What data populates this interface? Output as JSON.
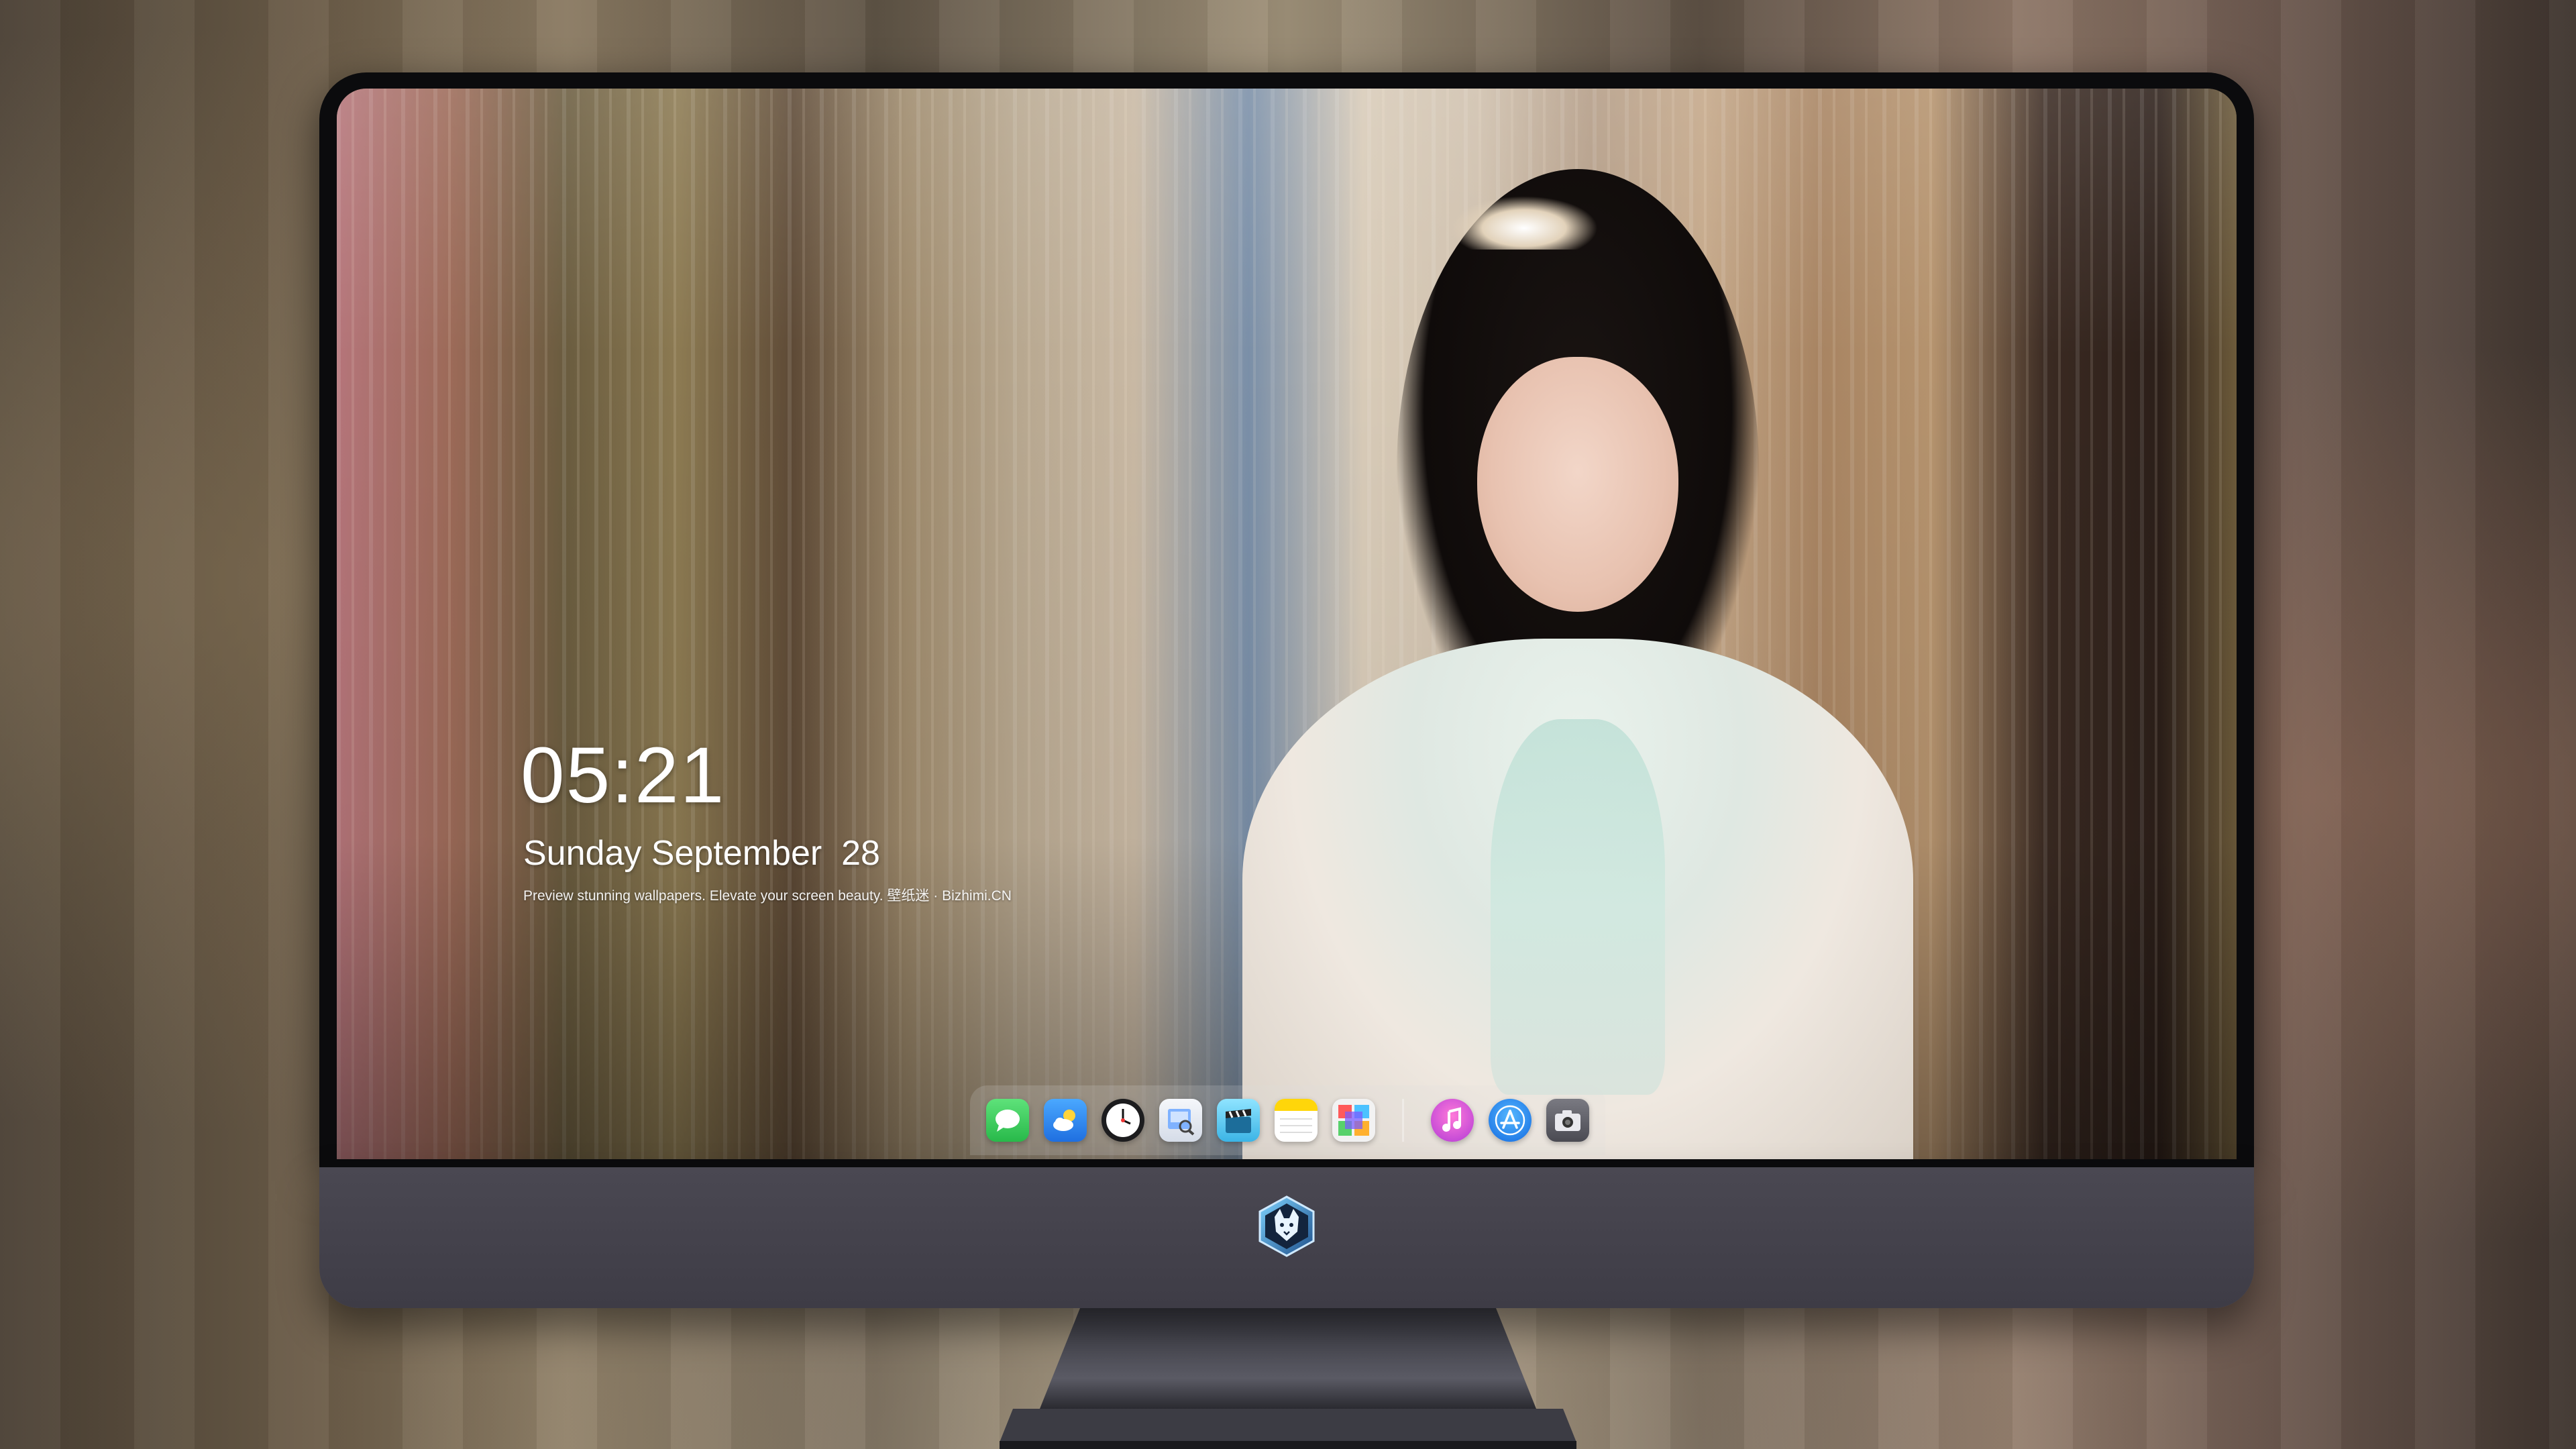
{
  "clock": {
    "time": "05:21",
    "date": "Sunday September  28",
    "tagline": "Preview stunning wallpapers. Elevate your screen beauty. 壁纸迷 · Bizhimi.CN"
  },
  "dock": {
    "apps": [
      {
        "name": "messages-icon",
        "color": "#34c759"
      },
      {
        "name": "weather-icon",
        "color": "#2f8cf0"
      },
      {
        "name": "clock-icon",
        "color": "#1c1c1e"
      },
      {
        "name": "preview-icon",
        "color": "#e9eef6"
      },
      {
        "name": "final-cut-icon",
        "color": "#5ac8fa"
      },
      {
        "name": "notes-icon",
        "color": "#ffd60a"
      },
      {
        "name": "photo-grid-icon",
        "color": "#f2f2f2"
      },
      {
        "name": "itunes-icon",
        "color": "#e052c8"
      },
      {
        "name": "app-store-icon",
        "color": "#1e8cff"
      },
      {
        "name": "camera-icon",
        "color": "#5a5a60"
      }
    ]
  },
  "logo": {
    "name": "wolf-badge-logo"
  }
}
